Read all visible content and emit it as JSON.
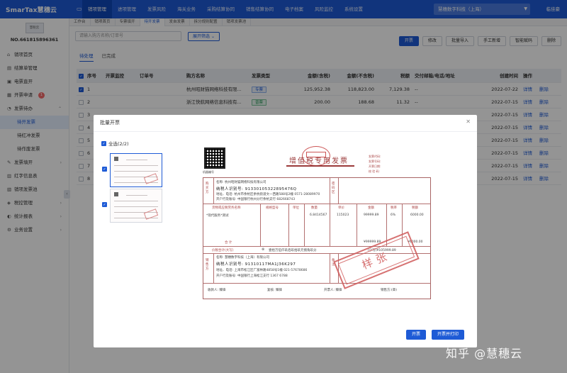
{
  "app": {
    "logo": "SmarTax慧穗云",
    "nav": [
      "销项管理",
      "进项管理",
      "发票风险",
      "海关业务",
      "采购结算协同",
      "销售结算协同",
      "电子档案",
      "风险监控",
      "系统设置"
    ],
    "company": "慧穗数字科技（上海）",
    "user": "临佳豪"
  },
  "sidebar": {
    "logo_label": "慧税云",
    "tax_no": "NO.661815896361",
    "items": [
      {
        "label": "销项首页",
        "icon": "home-icon"
      },
      {
        "label": "结算单管理",
        "icon": "doc-icon"
      },
      {
        "label": "电票直开",
        "icon": "ticket-icon"
      },
      {
        "label": "开票申请",
        "icon": "form-icon",
        "badge": "1"
      },
      {
        "label": "发票待办",
        "icon": "bell-icon"
      },
      {
        "label": "待开发票",
        "sub": true
      },
      {
        "label": "待红冲发票",
        "sub": true
      },
      {
        "label": "待作废发票",
        "sub": true
      },
      {
        "label": "发票填开",
        "icon": "pen-icon"
      },
      {
        "label": "红字信息表",
        "icon": "table-icon"
      },
      {
        "label": "销项发票池",
        "icon": "pool-icon"
      },
      {
        "label": "税控管理",
        "icon": "shield-icon"
      },
      {
        "label": "统计报表",
        "icon": "chart-icon"
      },
      {
        "label": "业务设置",
        "icon": "gear-icon"
      }
    ]
  },
  "tabs": [
    "工作台",
    "销项首页",
    "专票填开",
    "待开发票",
    "发自发票",
    "拆分规则配置",
    "销项发票池"
  ],
  "toolbar": {
    "search_placeholder": "请输入购方名称/订单号",
    "filter_label": "展开筛选",
    "actions": [
      "开票",
      "修改",
      "批量导入",
      "手工新增",
      "智能赋码",
      "删除"
    ]
  },
  "subtabs": [
    "待处理",
    "已完成"
  ],
  "table": {
    "headers": [
      "序号",
      "开票监控",
      "订单号",
      "购方名称",
      "发票类型",
      "金额(含税)",
      "金额(不含税)",
      "税额",
      "交付邮箱/电话/地址",
      "创建时间",
      "操作"
    ],
    "rows": [
      {
        "idx": "1",
        "buyer": "杭州昭财猫网络科技有限...",
        "type": "专票",
        "amt": "125,952.38",
        "amtn": "118,823.00",
        "tax": "7,129.38",
        "deliv": "--",
        "date": "2022-07-22",
        "checked": true
      },
      {
        "idx": "2",
        "buyer": "浙江快航网络信息科技有...",
        "type": "普票",
        "amt": "200.00",
        "amtn": "188.68",
        "tax": "11.32",
        "deliv": "--",
        "date": "2022-07-15",
        "checked": false
      },
      {
        "idx": "3",
        "buyer": "",
        "type": "",
        "amt": "",
        "amtn": "",
        "tax": "",
        "deliv": "",
        "date": "2022-07-15",
        "checked": false
      },
      {
        "idx": "4",
        "buyer": "",
        "type": "",
        "amt": "",
        "amtn": "",
        "tax": "",
        "deliv": "",
        "date": "2022-07-15",
        "checked": false
      },
      {
        "idx": "5",
        "buyer": "",
        "type": "",
        "amt": "",
        "amtn": "",
        "tax": "",
        "deliv": "",
        "date": "2022-07-15",
        "checked": false
      },
      {
        "idx": "6",
        "buyer": "",
        "type": "",
        "amt": "",
        "amtn": "",
        "tax": "",
        "deliv": "",
        "date": "2022-07-15",
        "checked": false
      },
      {
        "idx": "7",
        "buyer": "",
        "type": "",
        "amt": "",
        "amtn": "",
        "tax": "",
        "deliv": "",
        "date": "2022-07-15",
        "checked": false
      },
      {
        "idx": "8",
        "buyer": "",
        "type": "",
        "amt": "",
        "amtn": "",
        "tax": "",
        "deliv": "",
        "date": "2022-07-15",
        "checked": false
      }
    ],
    "ops": [
      "详情",
      "删除"
    ]
  },
  "modal": {
    "title": "批量开票",
    "select_all": "全选(2/2)",
    "invoice": {
      "title": "增值税专用发票",
      "qr_caption": "机器编号",
      "meta": [
        "发票代码:",
        "发票号码:",
        "开票日期:",
        "校 验 码:"
      ],
      "buyer_label": "购买方",
      "buyer_name": "名称: 杭州昭财猫网络科技有限公司",
      "buyer_tax": "纳税人识别号: 91330105322895476Q",
      "buyer_addr": "地址、电话: 杭州市余杭区余杭街道文一西路588号2幢 0571-28089970",
      "buyer_bank": "开户行及账号: 中国银行杭州分行余杭支行 682668743",
      "password_label": "密码区",
      "col_headers": [
        "货物或应税劳务名称",
        "规格型号",
        "单位",
        "数量",
        "单价",
        "金额",
        "税率",
        "税额"
      ],
      "item_name": "*现代服务*测试",
      "item_qty": "6.8414567",
      "item_price": "115023",
      "item_amount": "99999.89",
      "item_rate": "6%",
      "item_tax": "6000.00",
      "total_label": "合 计",
      "total_amount": "¥99999.89",
      "total_tax": "¥6000.00",
      "words_label": "价税合计(大写)",
      "words_value": "壹拾万伍仟玖佰玖拾玖元捌角玖分",
      "words_small": "(小写)¥105999.89",
      "seller_label": "销售方",
      "seller_name": "名称: 慧穗数字科技（上海）有限公司",
      "seller_tax": "纳税人识别号: 91310117MA1J36K297",
      "seller_addr": "地址、电话: 上海市松江区广富林路4858号1幢 021-57678686",
      "seller_bank": "开户行及账号: 中国银行上海松江支行 1367 6788",
      "remark_label": "备注",
      "payee": "收款人: 臻锋",
      "reviewer": "复核: 臻锋",
      "drawer": "开票人: 臻锋",
      "seller_sign": "销售方:(章)",
      "sample_stamp": "样张"
    },
    "buttons": {
      "issue": "开票",
      "issue_print": "开票并打印"
    }
  },
  "watermark": "知乎 @慧穗云",
  "colors": {
    "primary": "#1e5bd6",
    "danger": "#f56c6c",
    "invoice_red": "#a44"
  }
}
